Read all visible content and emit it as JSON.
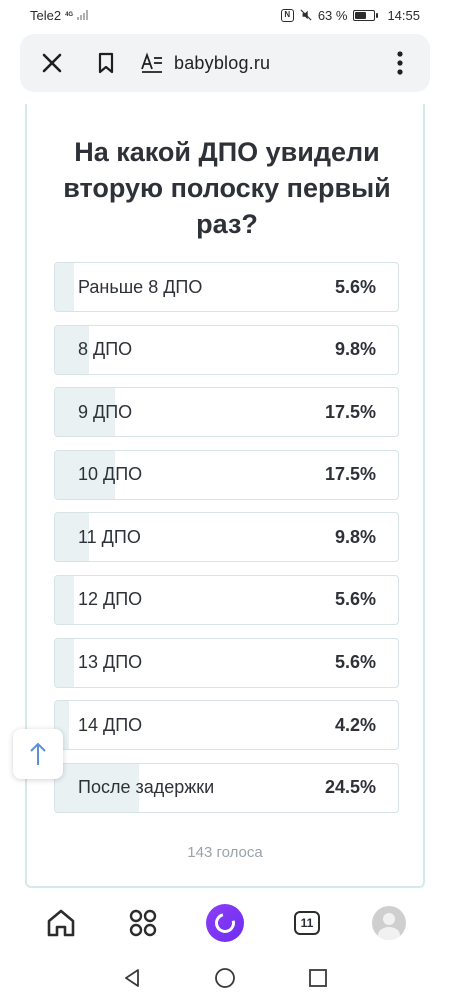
{
  "status_bar": {
    "carrier": "Tele2",
    "network": "4G",
    "battery_percent": "63 %",
    "time": "14:55",
    "battery_level": 0.63
  },
  "browser": {
    "url": "babyblog.ru",
    "icons": [
      "close-icon",
      "bookmark-icon",
      "reader-mode-icon",
      "more-vertical-icon"
    ]
  },
  "poll": {
    "title": "На какой ДПО увидели вторую полоску первый раз?",
    "options": [
      {
        "label": "Раньше 8 ДПО",
        "percent": "5.6%",
        "value": 5.6
      },
      {
        "label": "8 ДПО",
        "percent": "9.8%",
        "value": 9.8
      },
      {
        "label": "9 ДПО",
        "percent": "17.5%",
        "value": 17.5
      },
      {
        "label": "10 ДПО",
        "percent": "17.5%",
        "value": 17.5
      },
      {
        "label": "11 ДПО",
        "percent": "9.8%",
        "value": 9.8
      },
      {
        "label": "12 ДПО",
        "percent": "5.6%",
        "value": 5.6
      },
      {
        "label": "13 ДПО",
        "percent": "5.6%",
        "value": 5.6
      },
      {
        "label": "14 ДПО",
        "percent": "4.2%",
        "value": 4.2
      },
      {
        "label": "После задержки",
        "percent": "24.5%",
        "value": 24.5
      }
    ],
    "votes": "143 голоса"
  },
  "bottom_nav": {
    "tabs_count": "11",
    "icons": [
      "home-icon",
      "apps-grid-icon",
      "alice-assistant-icon",
      "tabs-icon",
      "profile-avatar"
    ]
  },
  "system_nav": {
    "icons": [
      "back-icon",
      "home-circle-icon",
      "recents-icon"
    ]
  },
  "colors": {
    "accent": "#7b35f3",
    "bar_fill": "#e9f1f3",
    "border": "#d7e3e5",
    "muted_text": "#9aa3aa"
  }
}
